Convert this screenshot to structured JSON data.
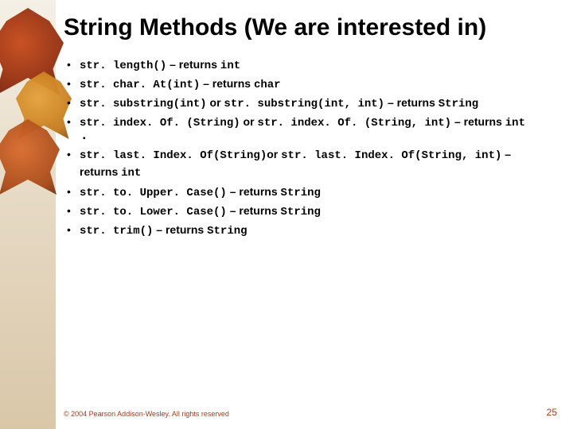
{
  "title": "String Methods (We are interested in)",
  "items": [
    {
      "m1": "str. length()",
      "or": "",
      "m2": "",
      "ret": "int",
      "sub": false
    },
    {
      "m1": "str. char. At(int)",
      "or": "",
      "m2": "",
      "ret": "char",
      "sub": false
    },
    {
      "m1": "str. substring(int)",
      "or": " or ",
      "m2": "str. substring(int, int)",
      "ret": "String",
      "sub": false
    },
    {
      "m1": "str. index. Of. (String)",
      "or": " or ",
      "m2": "str. index. Of. (String, int)",
      "ret": "int",
      "sub": true
    },
    {
      "m1": "str. last. Index. Of(String)",
      "or": "or ",
      "m2": " str. last. Index. Of(String, int)",
      "ret": "int",
      "sub": false
    },
    {
      "m1": "str. to. Upper. Case()",
      "or": "",
      "m2": "",
      "ret": "String",
      "sub": false
    },
    {
      "m1": "str. to. Lower. Case()",
      "or": "",
      "m2": "",
      "ret": "String",
      "sub": false
    },
    {
      "m1": "str. trim()",
      "or": "",
      "m2": "",
      "ret": "String",
      "sub": false
    }
  ],
  "returns_label": " – returns ",
  "footer": "© 2004 Pearson Addison-Wesley. All rights reserved",
  "page": "25"
}
